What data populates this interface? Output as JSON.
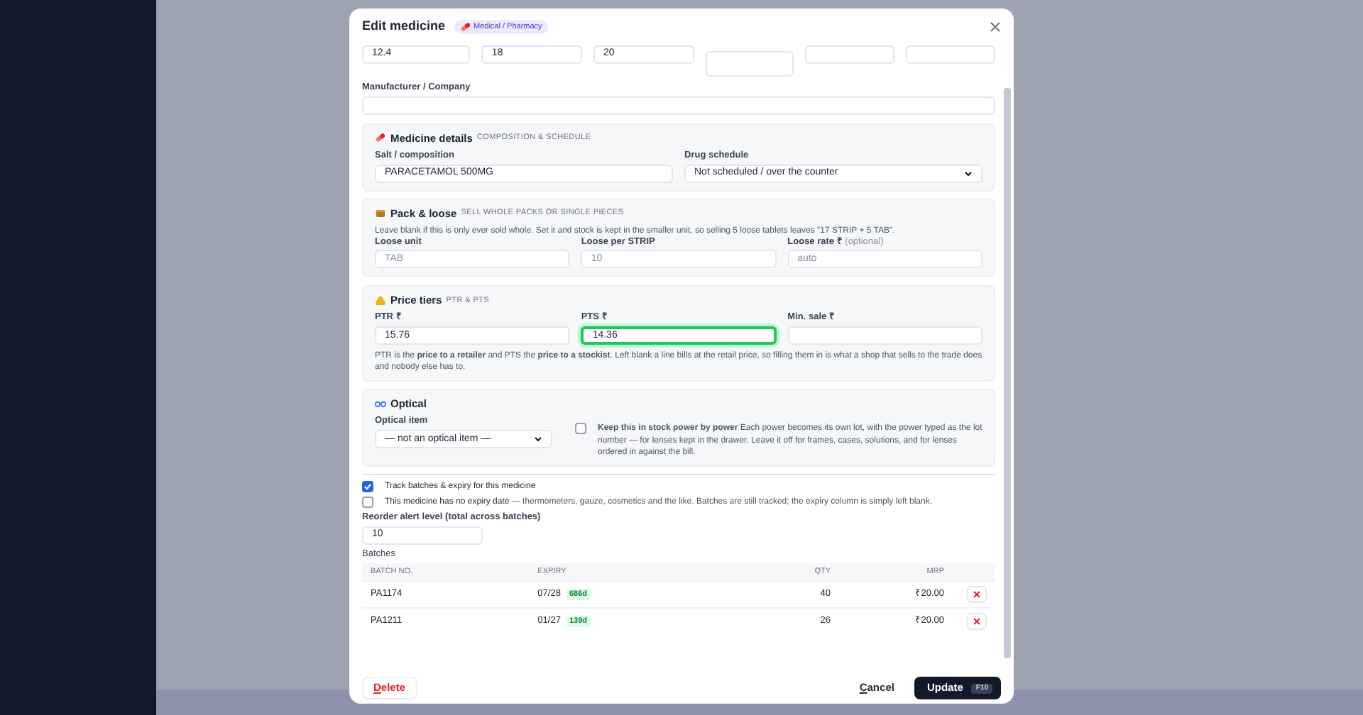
{
  "modal": {
    "title": "Edit medicine",
    "badge": "Medical / Pharmacy"
  },
  "top_fields": [
    {
      "kind": "plain",
      "value": "12.4"
    },
    {
      "kind": "plain",
      "value": "18"
    },
    {
      "kind": "plain",
      "value": "20"
    },
    {
      "kind": "tall"
    },
    {
      "kind": "plain"
    },
    {
      "kind": "plain"
    }
  ],
  "manufacturer": {
    "label": "Manufacturer / Company"
  },
  "medicine_details": {
    "title": "Medicine details",
    "subtitle": "COMPOSITION & SCHEDULE",
    "salt": {
      "label": "Salt / composition",
      "value": "PARACETAMOL 500MG"
    },
    "schedule": {
      "label": "Drug schedule",
      "value": "Not scheduled / over the counter"
    }
  },
  "pack_loose": {
    "title": "Pack & loose",
    "subtitle": "SELL WHOLE PACKS OR SINGLE PIECES",
    "note": "Leave blank if this is only ever sold whole. Set it and stock is kept in the smaller unit, so selling 5 loose tablets leaves \"17 STRIP + 5 TAB\".",
    "fields": [
      {
        "label": "Loose unit",
        "placeholder": "TAB"
      },
      {
        "label": "Loose per STRIP",
        "placeholder": "10"
      },
      {
        "label": "Loose rate ₹",
        "hint": "(optional)",
        "placeholder": "auto"
      }
    ]
  },
  "price_tiers": {
    "title": "Price tiers",
    "subtitle": "PTR & PTS",
    "fields": [
      {
        "label": "PTR ₹",
        "value": "15.76",
        "focused": false
      },
      {
        "label": "PTS ₹",
        "value": "14.36",
        "focused": true
      },
      {
        "label": "Min. sale ₹",
        "focused": false
      }
    ],
    "note": "PTR is the **price to a retailer** and PTS the **price to a stockist**. Left blank a line bills at the retail price, so filling them in is what a shop that sells to the trade does and nobody else has to."
  },
  "optical": {
    "title": "Optical",
    "select": {
      "label": "Optical item",
      "value": "— not an optical item —"
    },
    "power": {
      "checked": false,
      "label": "Keep this in stock power by power",
      "text": "Each power becomes its own lot, with the power typed as the lot number — for lenses kept in the drawer. Leave it off for frames, cases, solutions, and for lenses ordered in against the bill."
    }
  },
  "options": [
    {
      "checked": true,
      "label": "Track batches & expiry for this medicine"
    },
    {
      "checked": false,
      "label": "This medicine has no expiry date",
      "text": "— thermometers, gauze, cosmetics and the like. Batches are still tracked; the expiry column is simply left blank."
    }
  ],
  "reorder": {
    "label": "Reorder alert level (total across batches)",
    "value": "10"
  },
  "batches": {
    "title": "Batches",
    "columns": [
      "BATCH NO.",
      "EXPIRY",
      "QTY",
      "MRP"
    ],
    "rows": [
      {
        "batch": "PA1174",
        "expiry": "07/28",
        "days": "686d",
        "qty": "40",
        "mrp": "₹20.00"
      },
      {
        "batch": "PA1211",
        "expiry": "01/27",
        "days": "139d",
        "qty": "26",
        "mrp": "₹20.00"
      }
    ]
  },
  "footer": {
    "delete": "Delete",
    "cancel": "Cancel",
    "update": "Update",
    "shortcut": "F10"
  }
}
